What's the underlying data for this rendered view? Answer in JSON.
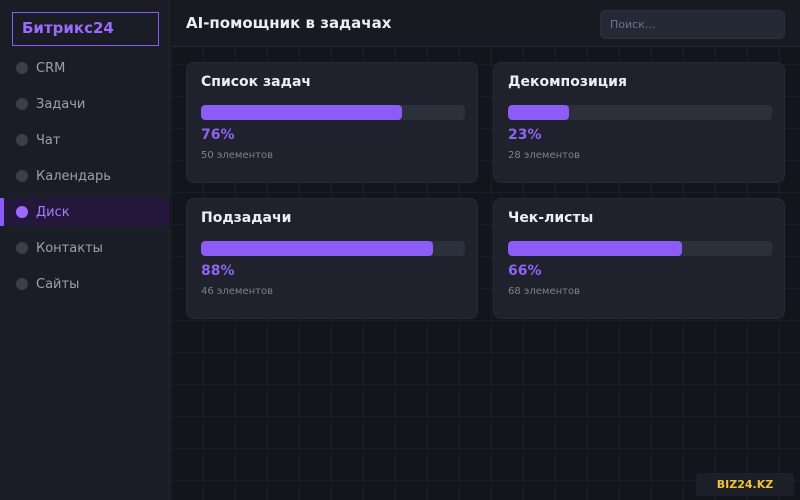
{
  "app": {
    "logo": "Битрикс24"
  },
  "sidebar": {
    "items": [
      {
        "label": "CRM",
        "active": false
      },
      {
        "label": "Задачи",
        "active": false
      },
      {
        "label": "Чат",
        "active": false
      },
      {
        "label": "Календарь",
        "active": false
      },
      {
        "label": "Диск",
        "active": true
      },
      {
        "label": "Контакты",
        "active": false
      },
      {
        "label": "Сайты",
        "active": false
      }
    ]
  },
  "header": {
    "title": "AI-помощник в задачах",
    "search_placeholder": "Поиск..."
  },
  "cards": [
    {
      "title": "Список задач",
      "progress": 76,
      "percent_label": "76%",
      "count_label": "50 элементов"
    },
    {
      "title": "Декомпозиция",
      "progress": 23,
      "percent_label": "23%",
      "count_label": "28 элементов"
    },
    {
      "title": "Подзадачи",
      "progress": 88,
      "percent_label": "88%",
      "count_label": "46 элементов"
    },
    {
      "title": "Чек-листы",
      "progress": 66,
      "percent_label": "66%",
      "count_label": "68 элементов"
    }
  ],
  "watermark": "BIZ24.KZ",
  "colors": {
    "accent": "#8b5cf6",
    "background": "#13151c",
    "card": "#1f222c",
    "watermark_text": "#f2c230"
  }
}
